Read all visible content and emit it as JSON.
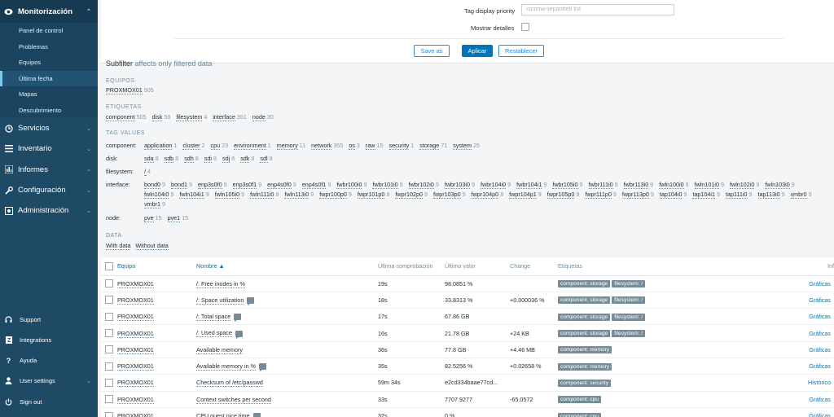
{
  "sidebar": {
    "monitoring": "Monitorización",
    "submenu": [
      "Panel de control",
      "Problemas",
      "Equipos",
      "Última fecha",
      "Mapas",
      "Descubrimiento"
    ],
    "main": [
      "Servicios",
      "Inventario",
      "Informes",
      "Configuración",
      "Administración"
    ],
    "bottom": [
      "Support",
      "Integrations",
      "Ayuda",
      "User settings",
      "Sign out"
    ]
  },
  "filter": {
    "tag_priority_label": "Tag display priority",
    "tag_priority_placeholder": "comma-separated list",
    "show_details_label": "Mostrar detalles",
    "save_as": "Save as",
    "apply": "Aplicar",
    "reset": "Restablecer"
  },
  "subfilter": {
    "title": "Subfilter",
    "note": "affects only filtered data",
    "hosts_title": "EQUIPOS",
    "hosts": [
      {
        "name": "PROXMOX01",
        "count": "505"
      }
    ],
    "tags_title": "ETIQUETAS",
    "tags": [
      {
        "name": "component",
        "count": "505"
      },
      {
        "name": "disk",
        "count": "56"
      },
      {
        "name": "filesystem",
        "count": "4"
      },
      {
        "name": "interface",
        "count": "351"
      },
      {
        "name": "node",
        "count": "30"
      }
    ],
    "tag_values_title": "TAG VALUES",
    "component_label": "component:",
    "component": [
      {
        "name": "application",
        "count": "1"
      },
      {
        "name": "cluster",
        "count": "2"
      },
      {
        "name": "cpu",
        "count": "23"
      },
      {
        "name": "environment",
        "count": "1"
      },
      {
        "name": "memory",
        "count": "11"
      },
      {
        "name": "network",
        "count": "355"
      },
      {
        "name": "os",
        "count": "3"
      },
      {
        "name": "raw",
        "count": "15"
      },
      {
        "name": "security",
        "count": "1"
      },
      {
        "name": "storage",
        "count": "71"
      },
      {
        "name": "system",
        "count": "25"
      }
    ],
    "disk_label": "disk:",
    "disk": [
      {
        "name": "sda",
        "count": "8"
      },
      {
        "name": "sdb",
        "count": "8"
      },
      {
        "name": "sdh",
        "count": "8"
      },
      {
        "name": "sdi",
        "count": "8"
      },
      {
        "name": "sdj",
        "count": "8"
      },
      {
        "name": "sdk",
        "count": "8"
      },
      {
        "name": "sdl",
        "count": "8"
      }
    ],
    "filesystem_label": "filesystem:",
    "filesystem": [
      {
        "name": "/",
        "count": "4"
      }
    ],
    "interface_label": "interface:",
    "interface_line1": [
      {
        "name": "bond0",
        "count": "9"
      },
      {
        "name": "bond1",
        "count": "9"
      },
      {
        "name": "enp3s0f0",
        "count": "9"
      },
      {
        "name": "enp3s0f1",
        "count": "9"
      },
      {
        "name": "enp4s0f0",
        "count": "9"
      },
      {
        "name": "enp4s0f1",
        "count": "9"
      },
      {
        "name": "fwbr100i0",
        "count": "9"
      },
      {
        "name": "fwbr101i0",
        "count": "9"
      },
      {
        "name": "fwbr102i0",
        "count": "9"
      },
      {
        "name": "fwbr103i0",
        "count": "9"
      },
      {
        "name": "fwbr104i0",
        "count": "9"
      },
      {
        "name": "fwbr104i1",
        "count": "9"
      },
      {
        "name": "fwbr105i0",
        "count": "9"
      },
      {
        "name": "fwbr111i0",
        "count": "9"
      },
      {
        "name": "fwbr113i0",
        "count": "9"
      },
      {
        "name": "fwln100i0",
        "count": "9"
      },
      {
        "name": "fwln101i0",
        "count": "9"
      },
      {
        "name": "fwln102i0",
        "count": "9"
      },
      {
        "name": "fwln103i0",
        "count": "9"
      }
    ],
    "interface_line2": [
      {
        "name": "fwln104i0",
        "count": "9"
      },
      {
        "name": "fwln104i1",
        "count": "9"
      },
      {
        "name": "fwln105i0",
        "count": "9"
      },
      {
        "name": "fwln111i0",
        "count": "9"
      },
      {
        "name": "fwln113i0",
        "count": "9"
      },
      {
        "name": "fwpr100p0",
        "count": "9"
      },
      {
        "name": "fwpr101p0",
        "count": "9"
      },
      {
        "name": "fwpr102p0",
        "count": "9"
      },
      {
        "name": "fwpr103p0",
        "count": "9"
      },
      {
        "name": "fwpr104p0",
        "count": "9"
      },
      {
        "name": "fwpr104p1",
        "count": "9"
      },
      {
        "name": "fwpr105p0",
        "count": "9"
      },
      {
        "name": "fwpr111p0",
        "count": "9"
      },
      {
        "name": "fwpr113p0",
        "count": "9"
      },
      {
        "name": "tap104i0",
        "count": "9"
      },
      {
        "name": "tap104i1",
        "count": "9"
      },
      {
        "name": "tap111i0",
        "count": "9"
      },
      {
        "name": "tap113i0",
        "count": "9"
      },
      {
        "name": "vmbr0",
        "count": "9"
      }
    ],
    "interface_line3": [
      {
        "name": "vmbr1",
        "count": "9"
      }
    ],
    "node_label": "node:",
    "node": [
      {
        "name": "pve",
        "count": "15"
      },
      {
        "name": "pve1",
        "count": "15"
      }
    ],
    "data_title": "DATA",
    "data": [
      "With data",
      "Without data"
    ]
  },
  "table": {
    "headers": [
      "Equipo",
      "Nombre ▲",
      "Última comprobación",
      "Último valor",
      "Change",
      "Etiquetas",
      "Inf"
    ],
    "rows": [
      {
        "host": "PROXMOX01",
        "name": "/: Free inodes in %",
        "hint": false,
        "last": "19s",
        "value": "98.0851 %",
        "change": "",
        "tags": [
          "component: storage",
          "filesystem: /"
        ],
        "link": "Gráficas"
      },
      {
        "host": "PROXMOX01",
        "name": "/: Space utilization",
        "hint": true,
        "last": "18s",
        "value": "33.8313 %",
        "change": "+0.000036 %",
        "tags": [
          "component: storage",
          "filesystem: /"
        ],
        "link": "Gráficas"
      },
      {
        "host": "PROXMOX01",
        "name": "/: Total space",
        "hint": true,
        "last": "17s",
        "value": "67.86 GB",
        "change": "",
        "tags": [
          "component: storage",
          "filesystem: /"
        ],
        "link": "Gráficas"
      },
      {
        "host": "PROXMOX01",
        "name": "/: Used space",
        "hint": true,
        "last": "16s",
        "value": "21.78 GB",
        "change": "+24 KB",
        "tags": [
          "component: storage",
          "filesystem: /"
        ],
        "link": "Gráficas"
      },
      {
        "host": "PROXMOX01",
        "name": "Available memory",
        "hint": false,
        "last": "36s",
        "value": "77.8 GB",
        "change": "+4.46 MB",
        "tags": [
          "component: memory"
        ],
        "link": "Gráficas"
      },
      {
        "host": "PROXMOX01",
        "name": "Available memory in %",
        "hint": true,
        "last": "35s",
        "value": "82.5256 %",
        "change": "+0.02658 %",
        "tags": [
          "component: memory"
        ],
        "link": "Gráficas"
      },
      {
        "host": "PROXMOX01",
        "name": "Checksum of /etc/passwd",
        "hint": false,
        "last": "59m 34s",
        "value": "e2cd334baae77cd...",
        "change": "",
        "tags": [
          "component: security"
        ],
        "link": "Histórico"
      },
      {
        "host": "PROXMOX01",
        "name": "Context switches per second",
        "hint": false,
        "last": "33s",
        "value": "7707.9277",
        "change": "-65.0572",
        "tags": [
          "component: cpu"
        ],
        "link": "Gráficas"
      },
      {
        "host": "PROXMOX01",
        "name": "CPU guest nice time",
        "hint": true,
        "last": "32s",
        "value": "0 %",
        "change": "",
        "tags": [
          "component: cpu"
        ],
        "link": "Gráficas"
      }
    ]
  }
}
